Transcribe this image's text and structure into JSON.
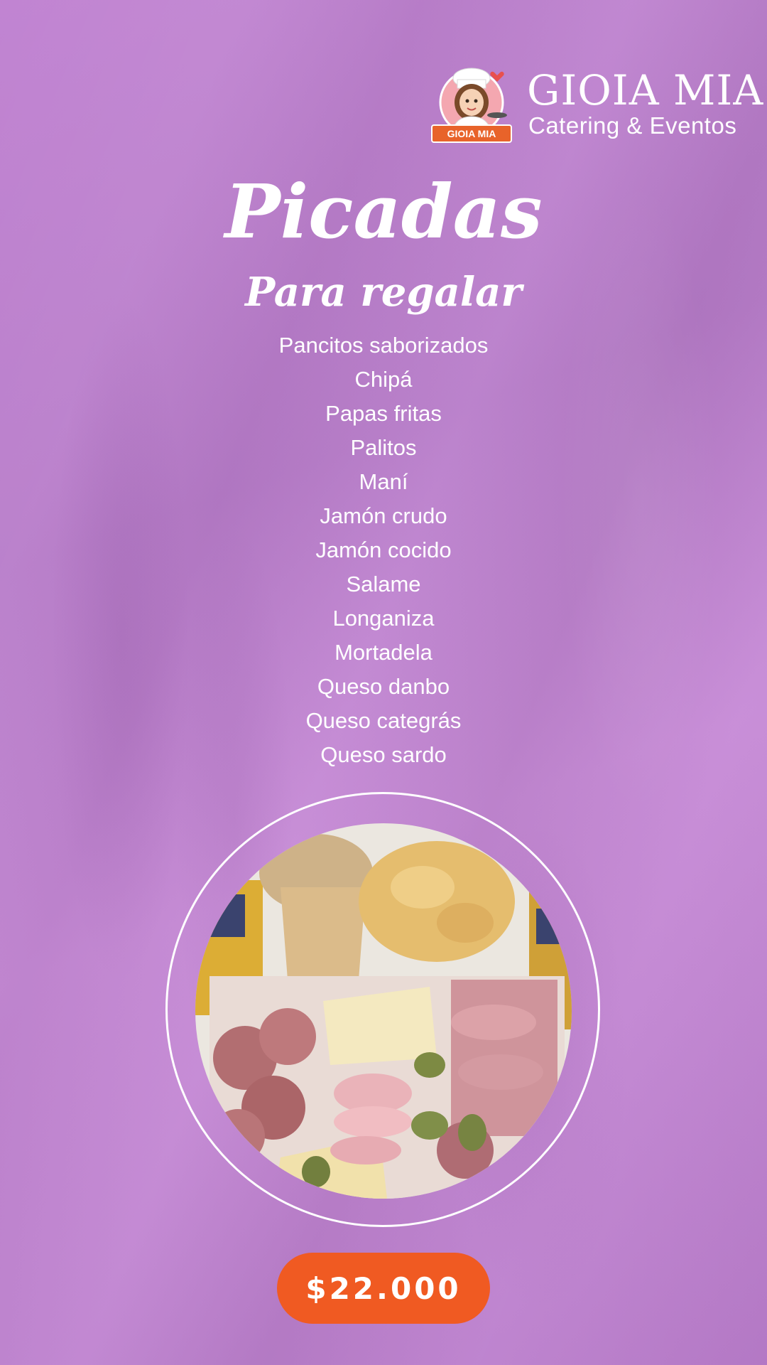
{
  "brand": {
    "name": "GIOIA MIA",
    "tagline": "Catering & Eventos",
    "logo_text": "GIOIA MIA"
  },
  "title": "Picadas",
  "subtitle": "Para regalar",
  "items": [
    "Pancitos saborizados",
    "Chipá",
    "Papas fritas",
    "Palitos",
    "Maní",
    "Jamón crudo",
    "Jamón cocido",
    "Salame",
    "Longaniza",
    "Mortadela",
    "Queso danbo",
    "Queso categrás",
    "Queso sardo"
  ],
  "price": "$22.000",
  "colors": {
    "background": "#bd80cf",
    "accent": "#f05a22",
    "text": "#ffffff"
  },
  "icons": {
    "logo": "chef-woman-logo",
    "photo": "picada-platter-photo"
  }
}
